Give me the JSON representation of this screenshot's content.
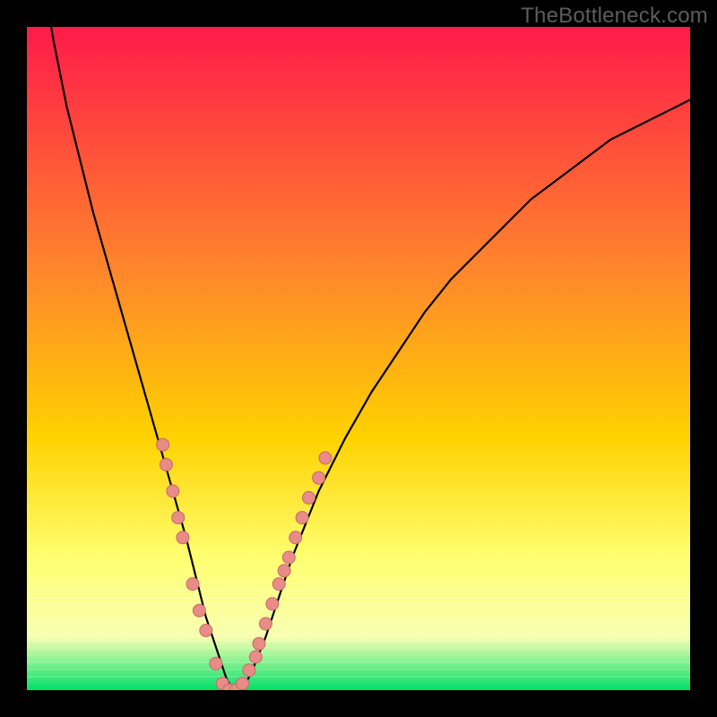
{
  "watermark": "TheBottleneck.com",
  "colors": {
    "bg_black": "#000000",
    "grad_top": "#ff1a4a",
    "grad_mid1": "#ff6a2a",
    "grad_mid2": "#ffd200",
    "grad_mid3": "#ffff70",
    "grad_mid4": "#f7ffb0",
    "grad_bottom": "#00e06a",
    "curve": "#000000",
    "marker_fill": "#e98b87",
    "marker_stroke": "#c46c68"
  },
  "chart_data": {
    "type": "line",
    "title": "",
    "xlabel": "",
    "ylabel": "",
    "xlim": [
      0,
      100
    ],
    "ylim": [
      0,
      100
    ],
    "series": [
      {
        "name": "bottleneck-curve",
        "x": [
          0,
          2,
          4,
          6,
          8,
          10,
          12,
          14,
          16,
          18,
          20,
          22,
          24,
          26,
          27,
          28,
          29,
          30,
          31,
          32,
          33,
          34,
          36,
          38,
          40,
          44,
          48,
          52,
          56,
          60,
          64,
          68,
          72,
          76,
          80,
          84,
          88,
          92,
          96,
          100
        ],
        "values": [
          130,
          110,
          98,
          88,
          80,
          72,
          65,
          58,
          51,
          44,
          37,
          30,
          23,
          15,
          11,
          8,
          5,
          2,
          0,
          0,
          1,
          3,
          8,
          14,
          20,
          30,
          38,
          45,
          51,
          57,
          62,
          66,
          70,
          74,
          77,
          80,
          83,
          85,
          87,
          89
        ]
      }
    ],
    "markers": [
      {
        "x": 20.5,
        "y": 37
      },
      {
        "x": 21.0,
        "y": 34
      },
      {
        "x": 22.0,
        "y": 30
      },
      {
        "x": 22.8,
        "y": 26
      },
      {
        "x": 23.5,
        "y": 23
      },
      {
        "x": 25.0,
        "y": 16
      },
      {
        "x": 26.0,
        "y": 12
      },
      {
        "x": 27.0,
        "y": 9
      },
      {
        "x": 28.5,
        "y": 4
      },
      {
        "x": 29.5,
        "y": 1
      },
      {
        "x": 30.5,
        "y": 0
      },
      {
        "x": 31.5,
        "y": 0
      },
      {
        "x": 32.5,
        "y": 1
      },
      {
        "x": 33.5,
        "y": 3
      },
      {
        "x": 34.5,
        "y": 5
      },
      {
        "x": 35.0,
        "y": 7
      },
      {
        "x": 36.0,
        "y": 10
      },
      {
        "x": 37.0,
        "y": 13
      },
      {
        "x": 38.0,
        "y": 16
      },
      {
        "x": 38.8,
        "y": 18
      },
      {
        "x": 39.5,
        "y": 20
      },
      {
        "x": 40.5,
        "y": 23
      },
      {
        "x": 41.5,
        "y": 26
      },
      {
        "x": 42.5,
        "y": 29
      },
      {
        "x": 44.0,
        "y": 32
      },
      {
        "x": 45.0,
        "y": 35
      }
    ]
  }
}
